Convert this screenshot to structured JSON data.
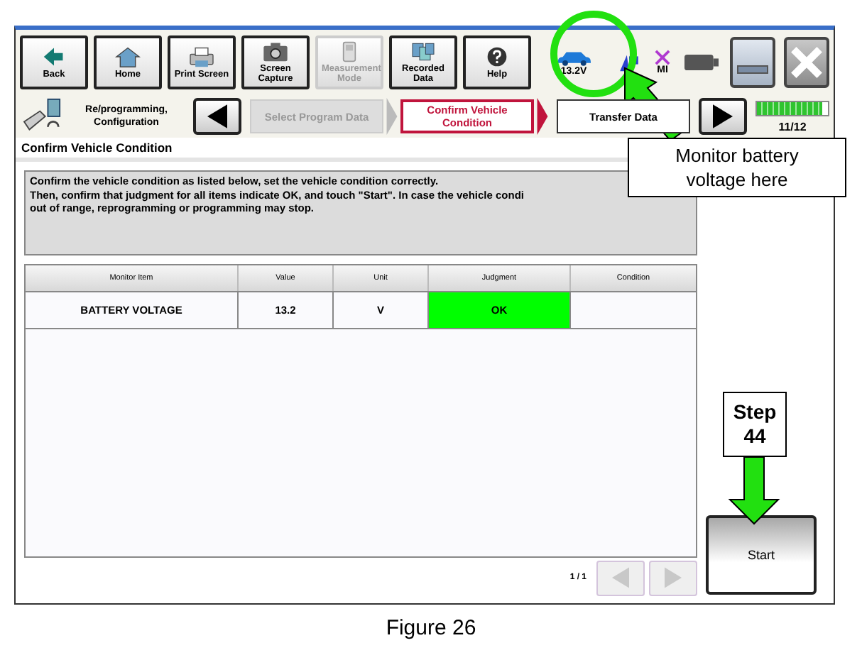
{
  "toolbar": {
    "buttons": [
      {
        "label": "Back",
        "kind": "back",
        "disabled": false
      },
      {
        "label": "Home",
        "kind": "home",
        "disabled": false
      },
      {
        "label": "Print Screen",
        "kind": "printer",
        "disabled": false
      },
      {
        "label": "Screen Capture",
        "kind": "camera",
        "disabled": false
      },
      {
        "label": "Measurement Mode",
        "kind": "meter",
        "disabled": true
      },
      {
        "label": "Recorded Data",
        "kind": "files",
        "disabled": false
      },
      {
        "label": "Help",
        "kind": "help",
        "disabled": false
      }
    ],
    "status": {
      "voltage": "13.2V",
      "mi_label": "MI"
    }
  },
  "breadcrumb": {
    "mode": "Re/programming, Configuration",
    "steps": [
      {
        "label": "Select Program Data",
        "completed": true,
        "selected": false
      },
      {
        "label": "Confirm Vehicle Condition",
        "completed": false,
        "selected": true
      },
      {
        "label": "Transfer Data",
        "completed": false,
        "selected": false
      }
    ],
    "progress": {
      "level": 0.92,
      "text": "11/12"
    }
  },
  "page_title": "Confirm Vehicle Condition",
  "description": [
    "Confirm the vehicle condition as listed below, set the vehicle condition correctly.",
    "Then, confirm that judgment for all items indicate OK, and touch \"Start\". In case the vehicle condi",
    "out of range, reprogramming or programming may stop."
  ],
  "table": {
    "columns": [
      "Monitor Item",
      "Value",
      "Unit",
      "Judgment",
      "Condition"
    ],
    "rows": [
      {
        "cells": [
          "BATTERY VOLTAGE",
          "13.2",
          "V",
          "OK",
          ""
        ],
        "judgment_ok": true
      }
    ]
  },
  "pager": {
    "text": "1 / 1"
  },
  "start_button": "Start",
  "callouts": [
    {
      "kind": "voltage",
      "text": "Monitor battery voltage here"
    },
    {
      "kind": "step",
      "text": "Step 44"
    }
  ],
  "caption": "Figure 26"
}
